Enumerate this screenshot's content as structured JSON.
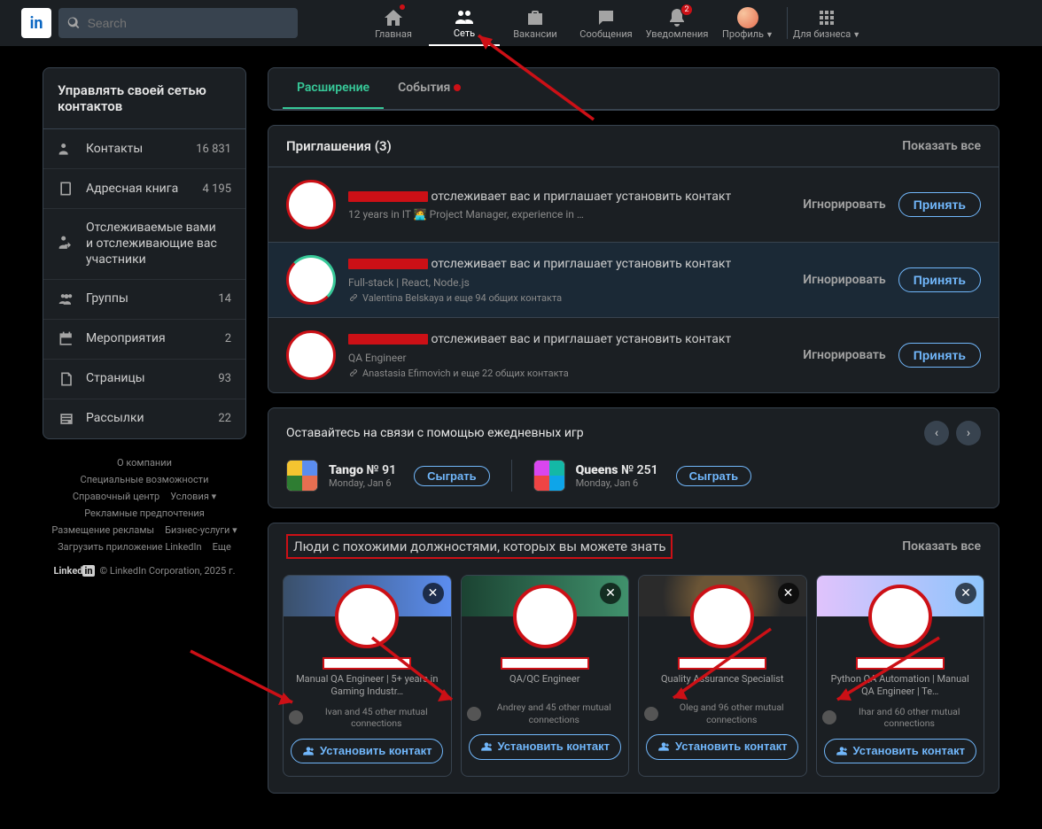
{
  "nav": {
    "logo": "in",
    "search_placeholder": "Search",
    "items": [
      {
        "label": "Главная",
        "icon": "home",
        "dot": true
      },
      {
        "label": "Сеть",
        "icon": "people",
        "active": true
      },
      {
        "label": "Вакансии",
        "icon": "briefcase"
      },
      {
        "label": "Сообщения",
        "icon": "message"
      },
      {
        "label": "Уведомления",
        "icon": "bell",
        "badge": "2"
      },
      {
        "label": "Профиль",
        "icon": "avatar",
        "caret": true
      }
    ],
    "biz_label": "Для бизнеса",
    "biz_icon": "grid"
  },
  "sidebar": {
    "header": "Управлять своей сетью контактов",
    "items": [
      {
        "icon": "people",
        "label": "Контакты",
        "count": "16 831"
      },
      {
        "icon": "book",
        "label": "Адресная книга",
        "count": "4 195"
      },
      {
        "icon": "follow",
        "label": "Отслеживаемые вами и отслеживающие вас участники",
        "count": ""
      },
      {
        "icon": "group",
        "label": "Группы",
        "count": "14"
      },
      {
        "icon": "calendar",
        "label": "Мероприятия",
        "count": "2"
      },
      {
        "icon": "page",
        "label": "Страницы",
        "count": "93"
      },
      {
        "icon": "newsletter",
        "label": "Рассылки",
        "count": "22"
      }
    ],
    "footer_links": [
      "О компании",
      "Специальные возможности",
      "Справочный центр",
      "Условия ▾",
      "Рекламные предпочтения",
      "Размещение рекламы",
      "Бизнес-услуги ▾",
      "Загрузить приложение LinkedIn",
      "Еще"
    ],
    "copyright": "© LinkedIn Corporation, 2025 г."
  },
  "tabs": [
    {
      "label": "Расширение",
      "active": true
    },
    {
      "label": "События",
      "dot": true
    }
  ],
  "invitations": {
    "title": "Приглашения (3)",
    "show_all": "Показать все",
    "follow_text": "отслеживает вас и приглашает установить контакт",
    "ignore": "Игнорировать",
    "accept": "Принять",
    "items": [
      {
        "sub": "12 years in IT 🧑‍💻 Project Manager, experience in …",
        "mutual": "",
        "highlighted": false
      },
      {
        "sub": "Full-stack | React, Node.js",
        "mutual": "Valentina Belskaya и еще 94 общих контакта",
        "highlighted": true
      },
      {
        "sub": "QA Engineer",
        "mutual": "Anastasia Efimovich и еще 22 общих контакта",
        "highlighted": false
      }
    ]
  },
  "games": {
    "title": "Оставайтесь на связи с помощью ежедневных игр",
    "play": "Сыграть",
    "items": [
      {
        "name": "Tango",
        "num": "№ 91",
        "date": "Monday, Jan 6"
      },
      {
        "name": "Queens",
        "num": "№ 251",
        "date": "Monday, Jan 6"
      }
    ]
  },
  "people": {
    "title": "Люди с похожими должностями, которых вы можете знать",
    "show_all": "Показать все",
    "connect": "Установить контакт",
    "items": [
      {
        "title": "Manual QA Engineer | 5+ years in Gaming Industr…",
        "mutual": "Ivan and 45 other mutual connections"
      },
      {
        "title": "QA/QC Engineer",
        "mutual": "Andrey and 45 other mutual connections"
      },
      {
        "title": "Quality Assurance Specialist",
        "mutual": "Oleg and 96 other mutual connections"
      },
      {
        "title": "Python QA Automation | Manual QA Engineer | Te…",
        "mutual": "Ihar and 60 other mutual connections"
      }
    ]
  }
}
